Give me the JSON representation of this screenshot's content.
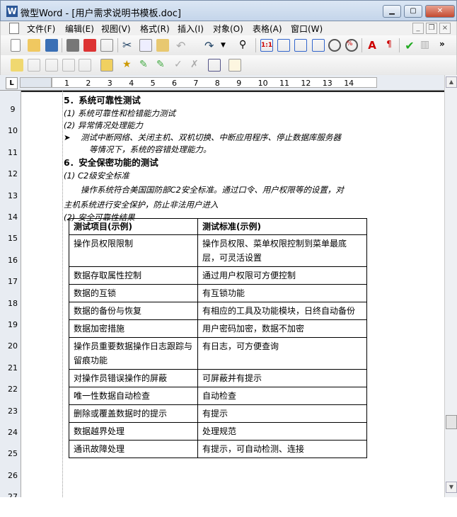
{
  "window": {
    "title": "微型Word - [用户需求说明书模板.doc]",
    "app_icon": "W"
  },
  "menu": [
    "文件(F)",
    "编辑(E)",
    "视图(V)",
    "格式(R)",
    "插入(I)",
    "对象(O)",
    "表格(A)",
    "窗口(W)"
  ],
  "ruler": {
    "corner": "L",
    "numbers": [
      "1",
      "2",
      "3",
      "4",
      "5",
      "6",
      "7",
      "8",
      "9",
      "10",
      "11",
      "12",
      "13",
      "14"
    ],
    "vertical": [
      "9",
      "10",
      "11",
      "12",
      "13",
      "14",
      "15",
      "16",
      "17",
      "18",
      "19",
      "20",
      "21",
      "22",
      "23",
      "24",
      "25",
      "26",
      "27"
    ]
  },
  "doc": {
    "h5": "5．系统可靠性测试",
    "l1": "(1) 系统可靠性和检错能力测试",
    "l2": "(2) 异常情况处理能力",
    "bullet1": "测试中断网络、关闭主机、双机切换、中断应用程序、停止数据库服务器",
    "bullet2": "等情况下，系统的容错处理能力。",
    "h6": "6．安全保密功能的测试",
    "l3": "(1) C2级安全标准",
    "p1": "操作系统符合美国国防部C2安全标准。通过口令、用户权限等的设置，对",
    "p2": "主机系统进行安全保护，防止非法用户进入",
    "l4": "(2) 安全可靠性结果",
    "table": {
      "headers": [
        "测试项目(示例)",
        "测试标准(示例)"
      ],
      "rows": [
        [
          "操作员权限限制",
          "操作员权限、菜单权限控制到菜单最底层，可灵活设置"
        ],
        [
          "数据存取属性控制",
          "通过用户权限可方便控制"
        ],
        [
          "数据的互锁",
          "有互锁功能"
        ],
        [
          "数据的备份与恢复",
          "有相应的工具及功能模块，日终自动备份"
        ],
        [
          "数据加密措施",
          "用户密码加密，数据不加密"
        ],
        [
          "操作员重要数据操作日志跟踪与留痕功能",
          "有日志，可方便查询"
        ],
        [
          "对操作员错误操作的屏蔽",
          "可屏蔽并有提示"
        ],
        [
          "唯一性数据自动检查",
          "自动检查"
        ],
        [
          "删除或覆盖数据时的提示",
          "有提示"
        ],
        [
          "数据越界处理",
          "处理规范"
        ],
        [
          "通讯故障处理",
          "有提示，可自动检测、连接"
        ]
      ]
    }
  }
}
